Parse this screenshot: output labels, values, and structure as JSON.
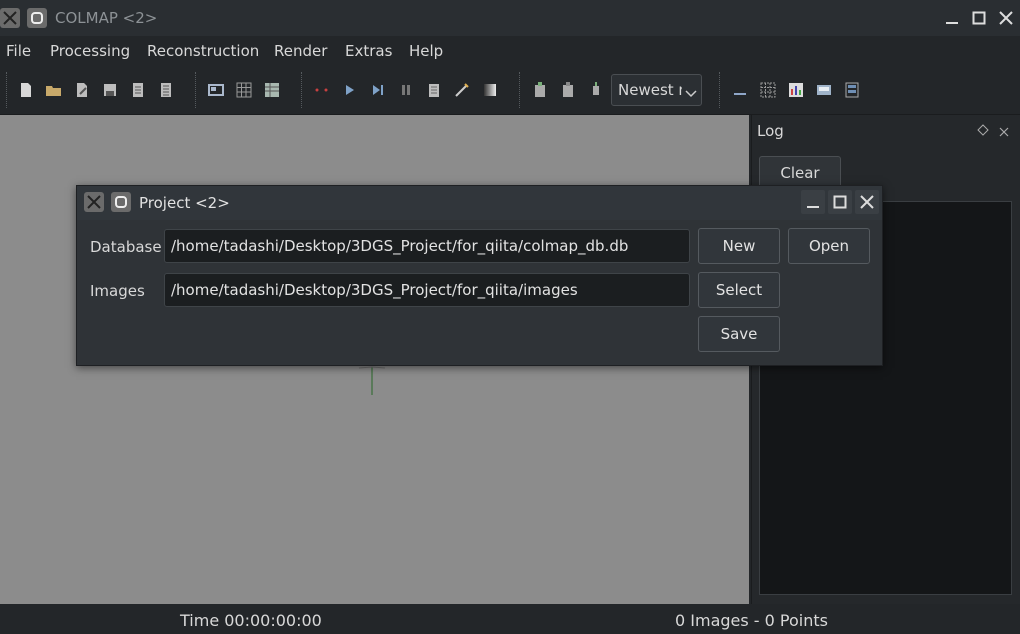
{
  "window": {
    "title": "COLMAP <2>"
  },
  "menu": [
    "File",
    "Processing",
    "Reconstruction",
    "Render",
    "Extras",
    "Help"
  ],
  "toolbar": {
    "icons": [
      "new-project-icon",
      "open-project-icon",
      "edit-project-icon",
      "save-project-icon",
      "import-icon",
      "export-icon",
      "feature-extraction-icon",
      "feature-matching-icon",
      "database-management-icon",
      "add-points-icon",
      "play-icon",
      "step-icon",
      "pause-icon",
      "bundle-adjustment-icon",
      "dense-reconstruction-icon",
      "gradient-icon",
      "render-options-icon",
      "reconstruction-stats-icon",
      "match-matrix-icon",
      "log-icon",
      "grab-image-icon",
      "tile-icon",
      "chart-icon",
      "screenshot-icon",
      "layers-icon"
    ],
    "combo_value": "Newest model"
  },
  "log_panel": {
    "title": "Log",
    "clear_label": "Clear"
  },
  "status": {
    "time": "Time 00:00:00:00",
    "counts": "0 Images - 0 Points"
  },
  "dialog": {
    "title": "Project <2>",
    "database_label": "Database",
    "database_value": "/home/tadashi/Desktop/3DGS_Project/for_qiita/colmap_db.db",
    "images_label": "Images",
    "images_value": "/home/tadashi/Desktop/3DGS_Project/for_qiita/images",
    "new_label": "New",
    "open_label": "Open",
    "select_label": "Select",
    "save_label": "Save"
  }
}
